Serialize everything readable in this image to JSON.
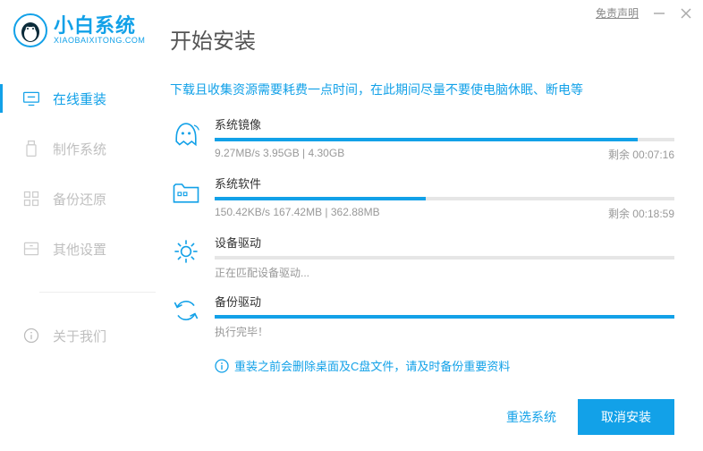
{
  "titlebar": {
    "disclaimer": "免责声明"
  },
  "logo": {
    "name": "小白系统",
    "sub": "XIAOBAIXITONG.COM"
  },
  "nav": {
    "online_reinstall": "在线重装",
    "make_system": "制作系统",
    "backup_restore": "备份还原",
    "other_settings": "其他设置",
    "about_us": "关于我们"
  },
  "page_title": "开始安装",
  "intro": "下载且收集资源需要耗费一点时间，在此期间尽量不要使电脑休眠、断电等",
  "tasks": {
    "image": {
      "title": "系统镜像",
      "status": "9.27MB/s 3.95GB | 4.30GB",
      "remain": "剩余 00:07:16",
      "percent": 92
    },
    "software": {
      "title": "系统软件",
      "status": "150.42KB/s 167.42MB | 362.88MB",
      "remain": "剩余 00:18:59",
      "percent": 46
    },
    "driver": {
      "title": "设备驱动",
      "status": "正在匹配设备驱动...",
      "percent": 0
    },
    "backup": {
      "title": "备份驱动",
      "status": "执行完毕！",
      "percent": 100
    }
  },
  "warning": "重装之前会删除桌面及C盘文件，请及时备份重要资料",
  "footer": {
    "reselect": "重选系统",
    "cancel": "取消安装"
  }
}
